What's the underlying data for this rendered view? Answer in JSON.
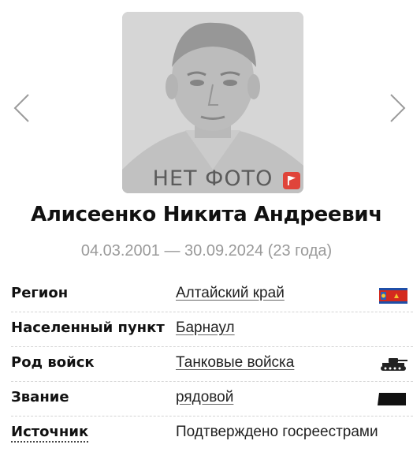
{
  "photo": {
    "caption": "НЕТ ФОТО",
    "placeholder_icon": "face-silhouette",
    "report_icon": "flag-icon",
    "report_color": "#e0443a"
  },
  "navigation": {
    "prev_icon": "chevron-left-icon",
    "next_icon": "chevron-right-icon"
  },
  "person": {
    "name": "Алисеенко Никита Андреевич",
    "dates": "04.03.2001 — 30.09.2024 (23 года)"
  },
  "details": [
    {
      "label": "Регион",
      "value": "Алтайский край",
      "icon": "region-flag-icon"
    },
    {
      "label": "Населенный пункт",
      "value": "Барнаул",
      "icon": ""
    },
    {
      "label": "Род войск",
      "value": "Танковые войска",
      "icon": "tank-icon"
    },
    {
      "label": "Звание",
      "value": "рядовой",
      "icon": "rank-stripe-icon"
    },
    {
      "label": "Источник",
      "value": "Подтверждено госреестрами",
      "icon": ""
    }
  ]
}
